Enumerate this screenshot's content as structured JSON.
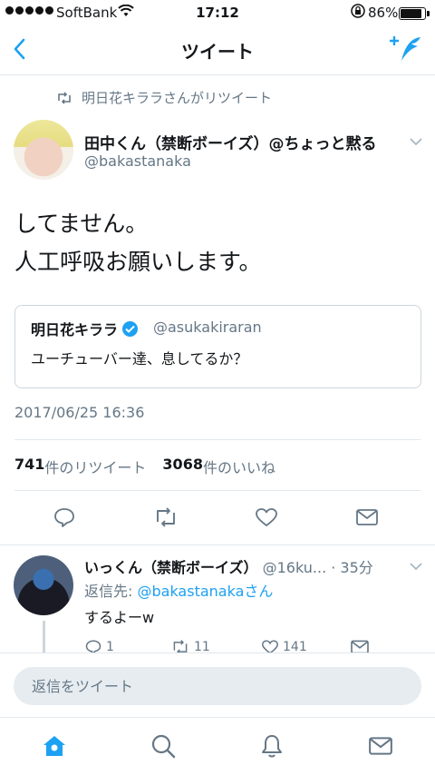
{
  "status_bar": {
    "carrier": "SoftBank",
    "time": "17:12",
    "battery": "86%",
    "battery_level": 0.86
  },
  "nav": {
    "title": "ツイート",
    "back_icon": "chevron-left-icon",
    "compose_icon": "compose-tweet-icon"
  },
  "tweet": {
    "retweet_notice": "明日花キララさんがリツイート",
    "author_name": "田中くん（禁断ボーイズ）@ちょっと黙る",
    "author_handle": "@bakastanaka",
    "text_line1": "してません。",
    "text_line2": "人工呼吸お願いします。",
    "quote": {
      "name": "明日花キララ",
      "handle": "@asukakiraran",
      "text": "ユーチューバー達、息してるか？"
    },
    "timestamp": "2017/06/25 16:36",
    "retweet_count": "741",
    "retweet_label": "件のリツイート",
    "like_count": "3068",
    "like_label": "件のいいね"
  },
  "reply": {
    "author_name": "いっくん（禁断ボーイズ）",
    "author_handle": "@16ku...",
    "time": "· 35分",
    "reply_to_prefix": "返信先: ",
    "reply_to_handle": "@bakastanaka",
    "reply_to_suffix": "さん",
    "text": "するよーw",
    "reply_count": "1",
    "retweet_count": "11",
    "like_count": "141"
  },
  "reply_input": {
    "placeholder": "返信をツイート"
  },
  "colors": {
    "accent": "#1da1f2",
    "secondary_text": "#657786",
    "divider": "#e1e8ed"
  }
}
